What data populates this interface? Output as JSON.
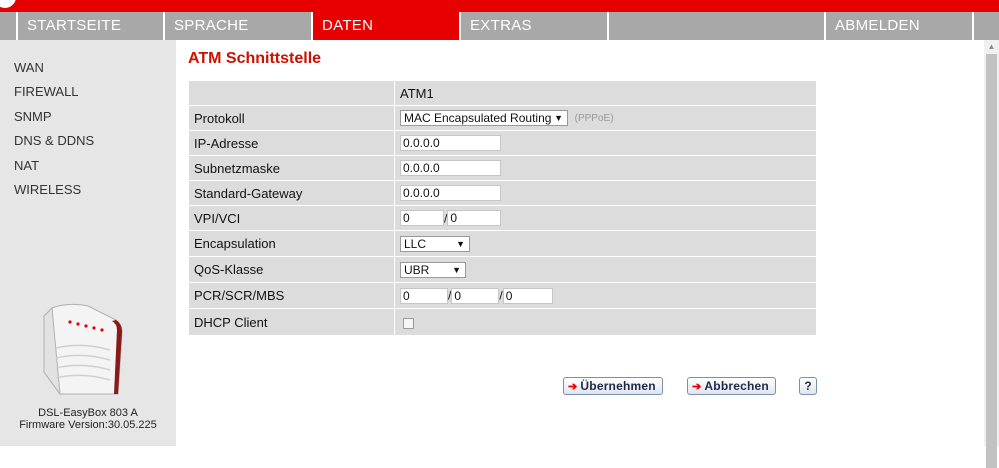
{
  "nav": {
    "items": [
      {
        "label": "STARTSEITE"
      },
      {
        "label": "SPRACHE"
      },
      {
        "label": "DATEN"
      },
      {
        "label": "EXTRAS"
      },
      {
        "label": ""
      },
      {
        "label": "ABMELDEN"
      }
    ],
    "active_index": 2
  },
  "sidebar": {
    "items": [
      {
        "label": "WAN"
      },
      {
        "label": "FIREWALL"
      },
      {
        "label": "SNMP"
      },
      {
        "label": "DNS & DDNS"
      },
      {
        "label": "NAT"
      },
      {
        "label": "WIRELESS"
      }
    ],
    "device_name": "DSL-EasyBox 803 A",
    "firmware": "Firmware Version:30.05.225"
  },
  "page": {
    "title": "ATM Schnittstelle",
    "column_header": "ATM1"
  },
  "form": {
    "protokoll": {
      "label": "Protokoll",
      "value": "MAC Encapsulated Routing",
      "hint": "(PPPoE)"
    },
    "ip": {
      "label": "IP-Adresse",
      "value": "0.0.0.0"
    },
    "subnet": {
      "label": "Subnetzmaske",
      "value": "0.0.0.0"
    },
    "gateway": {
      "label": "Standard-Gateway",
      "value": "0.0.0.0"
    },
    "vpivci": {
      "label": "VPI/VCI",
      "vpi": "0",
      "vci": "0",
      "sep": "/"
    },
    "encapsulation": {
      "label": "Encapsulation",
      "value": "LLC"
    },
    "qos": {
      "label": "QoS-Klasse",
      "value": "UBR"
    },
    "pcr": {
      "label": "PCR/SCR/MBS",
      "pcr": "0",
      "scr": "0",
      "mbs": "0",
      "sep": "/"
    },
    "dhcp": {
      "label": "DHCP Client",
      "checked": false
    }
  },
  "buttons": {
    "apply": "Übernehmen",
    "cancel": "Abbrechen",
    "help": "?"
  },
  "icons": {
    "dropdown": "chevron-down-icon",
    "button_arrow": "arrow-right-icon"
  },
  "colors": {
    "brand_red": "#e60000",
    "nav_gray": "#a8a8a8",
    "title_red": "#cc1100",
    "row_gray": "#dcdcdc"
  }
}
